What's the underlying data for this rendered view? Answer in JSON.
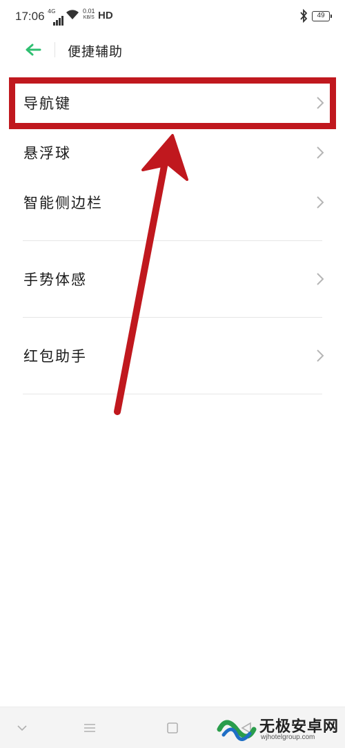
{
  "status_bar": {
    "time": "17:06",
    "network": "4G",
    "speed_value": "0.01",
    "speed_unit": "KB/S",
    "hd": "HD",
    "battery": "49",
    "icons": [
      "signal-icon",
      "wifi-icon",
      "bluetooth-icon",
      "battery-icon"
    ]
  },
  "header": {
    "back_icon": "arrow-left-icon",
    "title": "便捷辅助"
  },
  "list": {
    "items": [
      {
        "label": "导航键"
      },
      {
        "label": "悬浮球"
      },
      {
        "label": "智能侧边栏"
      },
      {
        "label": "手势体感"
      },
      {
        "label": "红包助手"
      }
    ]
  },
  "nav_bar": {
    "icons": [
      "chevron-down-icon",
      "menu-icon",
      "home-square-icon",
      "back-triangle-icon"
    ]
  },
  "watermark": {
    "brand": "无极安卓网",
    "url": "wjhotelgroup.com"
  },
  "colors": {
    "accent": "#2fbf71",
    "annotation_red": "#c0181e",
    "divider": "#e6e6e6",
    "chevron": "#b5b5b5"
  }
}
